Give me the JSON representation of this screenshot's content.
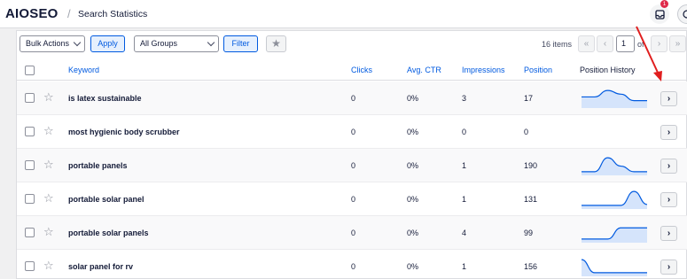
{
  "header": {
    "logo_prefix": "AIOS",
    "logo_suffix": "",
    "logo_text": "AIOSEO",
    "separator": "/",
    "title": "Search Statistics",
    "notification_count": "1"
  },
  "toolbar": {
    "bulk_actions": "Bulk Actions",
    "apply": "Apply",
    "groups": "All Groups",
    "filter": "Filter",
    "items_count": "16 items",
    "page_current": "1",
    "page_of": "of",
    "pg_first": "«",
    "pg_prev": "‹",
    "pg_next": "›",
    "pg_last": "»"
  },
  "table": {
    "headers": {
      "keyword": "Keyword",
      "clicks": "Clicks",
      "ctr": "Avg. CTR",
      "impressions": "Impressions",
      "position": "Position",
      "history": "Position History"
    },
    "rows": [
      {
        "keyword": "is latex sustainable",
        "clicks": "0",
        "ctr": "0%",
        "impressions": "3",
        "position": "17",
        "history": [
          0.55,
          0.55,
          0.9,
          0.7,
          0.35,
          0.35
        ],
        "has_history": true
      },
      {
        "keyword": "most hygienic body scrubber",
        "clicks": "0",
        "ctr": "0%",
        "impressions": "0",
        "position": "0",
        "history": [],
        "has_history": false
      },
      {
        "keyword": "portable panels",
        "clicks": "0",
        "ctr": "0%",
        "impressions": "1",
        "position": "190",
        "history": [
          0.15,
          0.15,
          0.9,
          0.45,
          0.15,
          0.15
        ],
        "has_history": true
      },
      {
        "keyword": "portable solar panel",
        "clicks": "0",
        "ctr": "0%",
        "impressions": "1",
        "position": "131",
        "history": [
          0.15,
          0.15,
          0.15,
          0.15,
          0.9,
          0.2
        ],
        "has_history": true
      },
      {
        "keyword": "portable solar panels",
        "clicks": "0",
        "ctr": "0%",
        "impressions": "4",
        "position": "99",
        "history": [
          0.15,
          0.15,
          0.15,
          0.75,
          0.75,
          0.75
        ],
        "has_history": true
      },
      {
        "keyword": "solar panel for rv",
        "clicks": "0",
        "ctr": "0%",
        "impressions": "1",
        "position": "156",
        "history": [
          0.85,
          0.15,
          0.15,
          0.15,
          0.15,
          0.15
        ],
        "has_history": true
      }
    ]
  },
  "icons": {
    "star": "☆",
    "star_filled": "★",
    "row_arrow": "›"
  },
  "colors": {
    "accent": "#005ae0",
    "spark_fill": "#d5e4fb",
    "annotation": "#e01e1e"
  }
}
